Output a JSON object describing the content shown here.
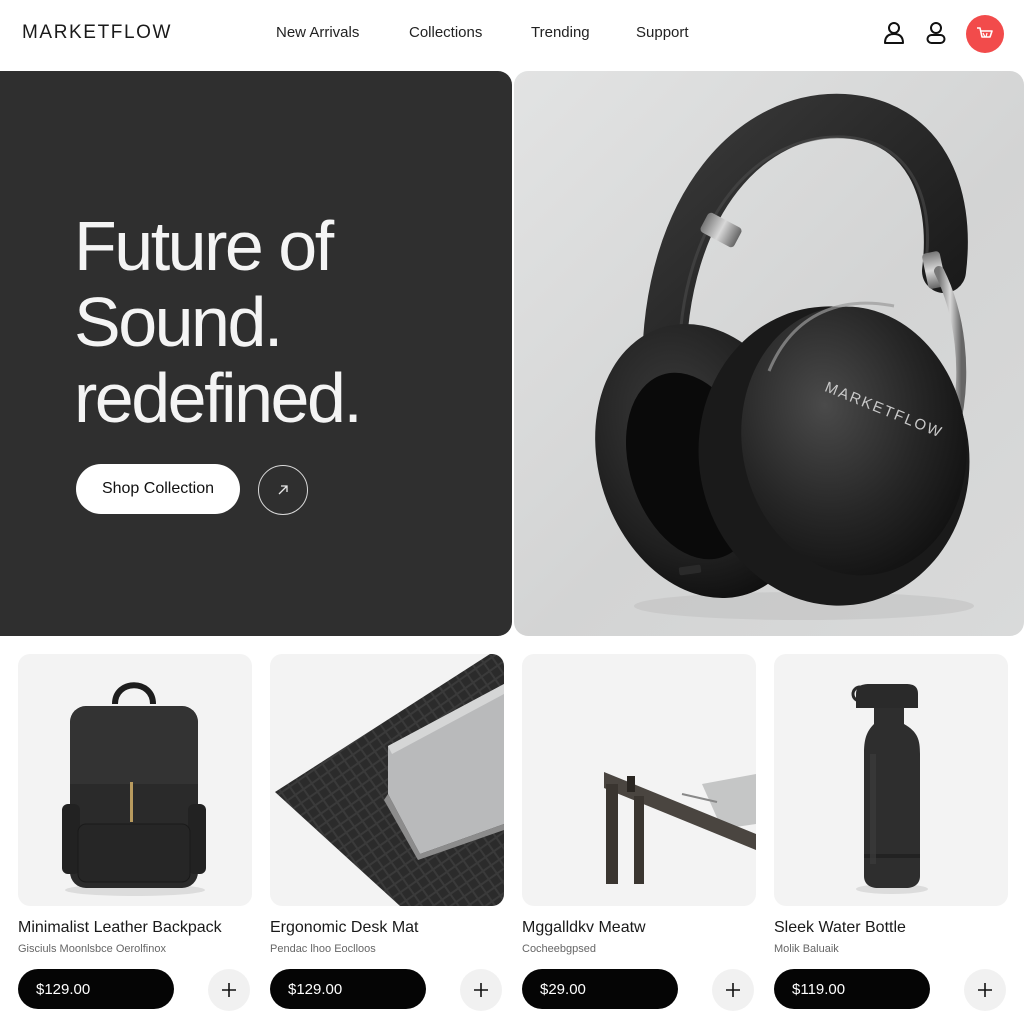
{
  "brand": {
    "logo": "MARKETFLOW"
  },
  "nav": {
    "items": [
      {
        "label": "New Arrivals"
      },
      {
        "label": "Collections"
      },
      {
        "label": "Trending"
      },
      {
        "label": "Support"
      }
    ]
  },
  "header_icons": [
    "account-icon",
    "profile-icon",
    "cart-icon"
  ],
  "colors": {
    "accent": "#f24b4b",
    "hero_dark": "#2f2f2f",
    "button_dark": "#050505"
  },
  "hero": {
    "title_lines": [
      "Future of",
      "Sound.",
      "redefined."
    ],
    "cta_label": "Shop Collection",
    "arrow_glyph": "↗",
    "product_brand_print": "MARKETFLOW"
  },
  "products": [
    {
      "name": "Minimalist Leather Backpack",
      "subtitle": "Gisciuls Moonlsbce Oerolfinox",
      "price": "$129.00"
    },
    {
      "name": "Ergonomic Desk Mat",
      "subtitle": "Pendac lhoo Eoclloos",
      "price": "$129.00"
    },
    {
      "name": "Mggalldkv Meatw",
      "subtitle": "Cocheebgpsed",
      "price": "$29.00"
    },
    {
      "name": "Sleek Water Bottle",
      "subtitle": "Molik Baluaik",
      "price": "$119.00"
    }
  ]
}
